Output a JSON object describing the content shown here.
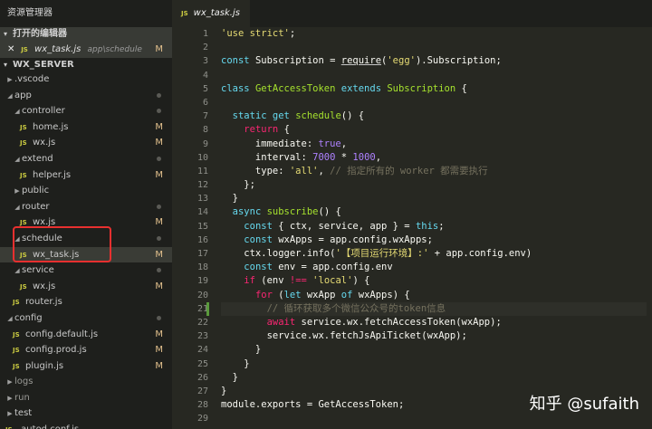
{
  "sidebar": {
    "header": "资源管理器",
    "open_editors_label": "打开的编辑器",
    "open_file": {
      "close": "✕",
      "type": "JS",
      "name": "wx_task.js",
      "path": "app\\schedule",
      "badge": "M"
    },
    "project_label": "WX_SERVER",
    "tree": [
      {
        "name": ".vscode",
        "type": "folder",
        "expanded": false,
        "depth": 0,
        "status": ""
      },
      {
        "name": "app",
        "type": "folder",
        "expanded": true,
        "depth": 0,
        "status": "dot"
      },
      {
        "name": "controller",
        "type": "folder",
        "expanded": true,
        "depth": 1,
        "status": "dot"
      },
      {
        "name": "home.js",
        "type": "js",
        "depth": 2,
        "status": "M"
      },
      {
        "name": "wx.js",
        "type": "js",
        "depth": 2,
        "status": "M"
      },
      {
        "name": "extend",
        "type": "folder",
        "expanded": true,
        "depth": 1,
        "status": "dot"
      },
      {
        "name": "helper.js",
        "type": "js",
        "depth": 2,
        "status": "M"
      },
      {
        "name": "public",
        "type": "folder",
        "expanded": false,
        "depth": 1,
        "status": ""
      },
      {
        "name": "router",
        "type": "folder",
        "expanded": true,
        "depth": 1,
        "status": "dot"
      },
      {
        "name": "wx.js",
        "type": "js",
        "depth": 2,
        "status": "M"
      },
      {
        "name": "schedule",
        "type": "folder",
        "expanded": true,
        "depth": 1,
        "status": "dot"
      },
      {
        "name": "wx_task.js",
        "type": "js",
        "depth": 2,
        "status": "M",
        "selected": true
      },
      {
        "name": "service",
        "type": "folder",
        "expanded": true,
        "depth": 1,
        "status": "dot"
      },
      {
        "name": "wx.js",
        "type": "js",
        "depth": 2,
        "status": "M"
      },
      {
        "name": "router.js",
        "type": "js",
        "depth": 1,
        "status": ""
      },
      {
        "name": "config",
        "type": "folder",
        "expanded": true,
        "depth": 0,
        "status": "dot"
      },
      {
        "name": "config.default.js",
        "type": "js",
        "depth": 1,
        "status": "M"
      },
      {
        "name": "config.prod.js",
        "type": "js",
        "depth": 1,
        "status": "M"
      },
      {
        "name": "plugin.js",
        "type": "js",
        "depth": 1,
        "status": "M"
      },
      {
        "name": "logs",
        "type": "folder",
        "expanded": false,
        "depth": 0,
        "status": "",
        "dim": true
      },
      {
        "name": "run",
        "type": "folder",
        "expanded": false,
        "depth": 0,
        "status": "",
        "dim": true
      },
      {
        "name": "test",
        "type": "folder",
        "expanded": false,
        "depth": 0,
        "status": ""
      },
      {
        "name": ".autod.conf.js",
        "type": "js",
        "depth": 0,
        "status": ""
      }
    ]
  },
  "editor": {
    "tab": {
      "type": "JS",
      "name": "wx_task.js"
    },
    "current_line": 21,
    "modified_line": 21,
    "lines": [
      [
        [
          "str",
          "'use strict'"
        ],
        [
          "pl",
          ";"
        ]
      ],
      [],
      [
        [
          "kw",
          "const "
        ],
        [
          "pl",
          "Subscription = "
        ],
        [
          "req",
          "require"
        ],
        [
          "pl",
          "("
        ],
        [
          "str",
          "'egg'"
        ],
        [
          "pl",
          ").Subscription;"
        ]
      ],
      [],
      [
        [
          "kw",
          "class "
        ],
        [
          "cls",
          "GetAccessToken "
        ],
        [
          "kw",
          "extends "
        ],
        [
          "cls",
          "Subscription "
        ],
        [
          "pl",
          "{"
        ]
      ],
      [],
      [
        [
          "pl",
          "  "
        ],
        [
          "kw",
          "static get "
        ],
        [
          "fn",
          "schedule"
        ],
        [
          "pl",
          "() {"
        ]
      ],
      [
        [
          "pl",
          "    "
        ],
        [
          "ctl",
          "return "
        ],
        [
          "pl",
          "{"
        ]
      ],
      [
        [
          "pl",
          "      immediate: "
        ],
        [
          "num",
          "true"
        ],
        [
          "pl",
          ","
        ]
      ],
      [
        [
          "pl",
          "      interval: "
        ],
        [
          "num",
          "7000"
        ],
        [
          "pl",
          " * "
        ],
        [
          "num",
          "1000"
        ],
        [
          "pl",
          ","
        ]
      ],
      [
        [
          "pl",
          "      type: "
        ],
        [
          "str",
          "'all'"
        ],
        [
          "pl",
          ", "
        ],
        [
          "cm",
          "// 指定所有的 worker 都需要执行"
        ]
      ],
      [
        [
          "pl",
          "    };"
        ]
      ],
      [
        [
          "pl",
          "  }"
        ]
      ],
      [
        [
          "pl",
          "  "
        ],
        [
          "kw",
          "async "
        ],
        [
          "fn",
          "subscribe"
        ],
        [
          "pl",
          "() {"
        ]
      ],
      [
        [
          "pl",
          "    "
        ],
        [
          "kw",
          "const "
        ],
        [
          "pl",
          "{ ctx, service, app } = "
        ],
        [
          "kw",
          "this"
        ],
        [
          "pl",
          ";"
        ]
      ],
      [
        [
          "pl",
          "    "
        ],
        [
          "kw",
          "const "
        ],
        [
          "pl",
          "wxApps = app.config.wxApps;"
        ]
      ],
      [
        [
          "pl",
          "    ctx.logger.info("
        ],
        [
          "str",
          "'【项目运行环境】:'"
        ],
        [
          "pl",
          " + app.config.env)"
        ]
      ],
      [
        [
          "pl",
          "    "
        ],
        [
          "kw",
          "const "
        ],
        [
          "pl",
          "env = app.config.env"
        ]
      ],
      [
        [
          "pl",
          "    "
        ],
        [
          "ctl",
          "if "
        ],
        [
          "pl",
          "(env "
        ],
        [
          "ctl",
          "!=="
        ],
        [
          "pl",
          " "
        ],
        [
          "str",
          "'local'"
        ],
        [
          "pl",
          ") {"
        ]
      ],
      [
        [
          "pl",
          "      "
        ],
        [
          "ctl",
          "for "
        ],
        [
          "pl",
          "("
        ],
        [
          "kw",
          "let "
        ],
        [
          "pl",
          "wxApp "
        ],
        [
          "kw",
          "of "
        ],
        [
          "pl",
          "wxApps) {"
        ]
      ],
      [
        [
          "pl",
          "        "
        ],
        [
          "cm",
          "// 循环获取多个微信公众号的token信息"
        ]
      ],
      [
        [
          "pl",
          "        "
        ],
        [
          "ctl",
          "await "
        ],
        [
          "pl",
          "service.wx.fetchAccessToken(wxApp);"
        ]
      ],
      [
        [
          "pl",
          "        service.wx.fetchJsApiTicket(wxApp);"
        ]
      ],
      [
        [
          "pl",
          "      }"
        ]
      ],
      [
        [
          "pl",
          "    }"
        ]
      ],
      [
        [
          "pl",
          "  }"
        ]
      ],
      [
        [
          "pl",
          "}"
        ]
      ],
      [
        [
          "pl",
          "module.exports = GetAccessToken;"
        ]
      ],
      []
    ]
  },
  "watermark": "知乎 @sufaith",
  "colors": {
    "annotation": "#e8302f",
    "modified": "#e2c08d",
    "js_icon": "#cbcb41"
  }
}
